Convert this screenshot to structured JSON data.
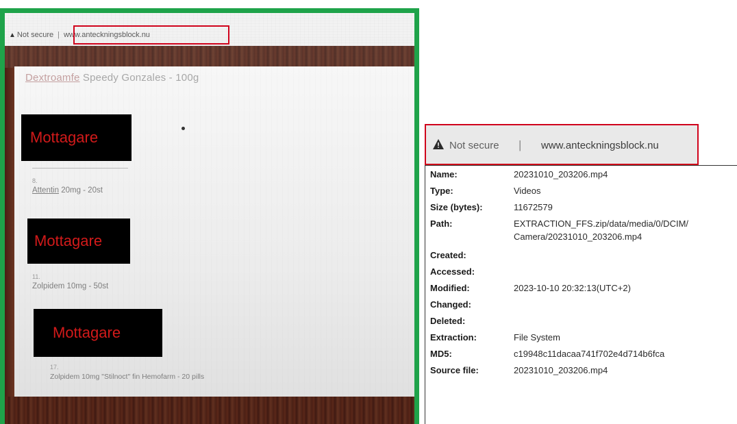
{
  "photo": {
    "address_bar": {
      "warning": "▲",
      "not_secure": "Not secure",
      "separator": "|",
      "url": "www.anteckningsblock.nu"
    },
    "heading": {
      "obscured": "Dextroamfe",
      "text": " Speedy Gonzales - 100g"
    },
    "redactions": [
      {
        "label": "Mottagare"
      },
      {
        "label": "Mottagare"
      },
      {
        "label": "Mottagare"
      }
    ],
    "items": [
      {
        "number": "8.",
        "text_u": "Attentin",
        "text": " 20mg - 20st"
      },
      {
        "number": "11.",
        "text_u": "",
        "text": "Zolpidem 10mg - 50st"
      },
      {
        "number": "17.",
        "text_u": "",
        "text": "Zolpidem 10mg \"Stilnoct\" fin Hemofarm - 20 pills"
      }
    ]
  },
  "address_bar": {
    "warning_icon": "warning-icon",
    "not_secure": "Not secure",
    "separator": "|",
    "url": "www.anteckningsblock.nu"
  },
  "file_properties": [
    {
      "label": "Name:",
      "value": "20231010_203206.mp4"
    },
    {
      "label": "Type:",
      "value": "Videos"
    },
    {
      "label": "Size (bytes):",
      "value": "11672579"
    },
    {
      "label": "Path:",
      "value": "EXTRACTION_FFS.zip/data/media/0/DCIM/",
      "value2": "Camera/20231010_203206.mp4"
    },
    {
      "label": "Created:",
      "value": ""
    },
    {
      "label": "Accessed:",
      "value": ""
    },
    {
      "label": "Modified:",
      "value": "2023-10-10 20:32:13(UTC+2)"
    },
    {
      "label": "Changed:",
      "value": ""
    },
    {
      "label": "Deleted:",
      "value": ""
    },
    {
      "label": "Extraction:",
      "value": "File System"
    },
    {
      "label": "MD5:",
      "value": "c19948c11dacaa741f702e4d714b6fca"
    },
    {
      "label": "Source file:",
      "value": "20231010_203206.mp4"
    }
  ],
  "colors": {
    "frame_green": "#1fa34a",
    "highlight_red": "#d0021b",
    "redaction_text": "#d21a1a"
  }
}
